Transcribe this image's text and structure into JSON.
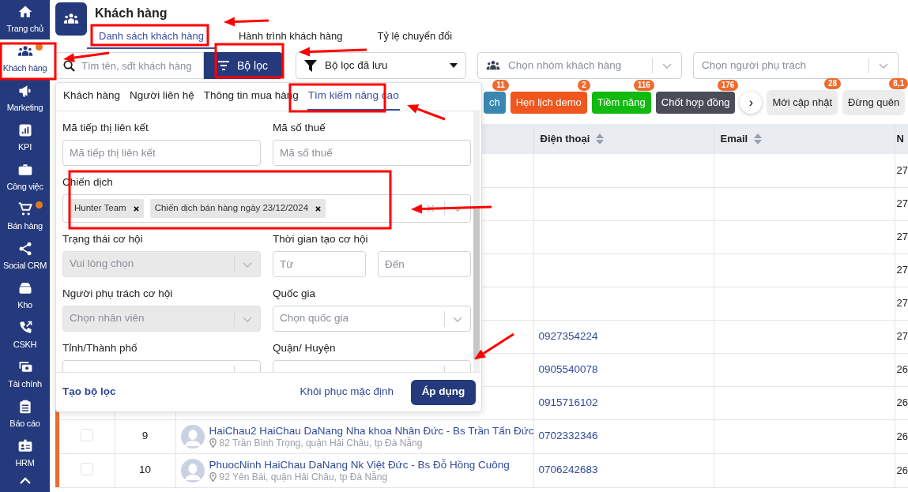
{
  "sidebar": {
    "items": [
      {
        "label": "Trang chủ",
        "selected": false,
        "dot": false
      },
      {
        "label": "Khách hàng",
        "selected": true,
        "dot": true
      },
      {
        "label": "Marketing",
        "selected": false,
        "dot": false
      },
      {
        "label": "KPI",
        "selected": false,
        "dot": false
      },
      {
        "label": "Công việc",
        "selected": false,
        "dot": false
      },
      {
        "label": "Bán hàng",
        "selected": false,
        "dot": true
      },
      {
        "label": "Social CRM",
        "selected": false,
        "dot": false
      },
      {
        "label": "Kho",
        "selected": false,
        "dot": false
      },
      {
        "label": "CSKH",
        "selected": false,
        "dot": false
      },
      {
        "label": "Tài chính",
        "selected": false,
        "dot": false
      },
      {
        "label": "Báo cáo",
        "selected": false,
        "dot": false
      },
      {
        "label": "HRM",
        "selected": false,
        "dot": false
      }
    ]
  },
  "header": {
    "title": "Khách hàng",
    "tabs": [
      {
        "label": "Danh sách khách hàng",
        "selected": true
      },
      {
        "label": "Hành trình khách hàng",
        "selected": false
      },
      {
        "label": "Tỷ lệ chuyển đổi",
        "selected": false
      }
    ]
  },
  "toolbar": {
    "search": {
      "placeholder": "Tìm tên, sđt khách hàng"
    },
    "filter_button": "Bộ lọc",
    "saved_filter": "Bộ lọc đã lưu",
    "group_select": {
      "placeholder": "Chọn nhóm khách hàng"
    },
    "owner_select": {
      "placeholder": "Chọn người phụ trách"
    }
  },
  "chips": [
    {
      "kind": "status",
      "label": "ch",
      "count": "11",
      "color": "#3a87b2"
    },
    {
      "kind": "status",
      "label": "Hẹn lịch demo",
      "count": "2",
      "color": "#f0561d"
    },
    {
      "kind": "status",
      "label": "Tiềm năng",
      "count": "116",
      "color": "#12b90f"
    },
    {
      "kind": "status",
      "label": "Chốt hợp đồng",
      "count": "176",
      "color": "#4a4d58"
    },
    {
      "kind": "scroll",
      "label": "›"
    },
    {
      "kind": "quick",
      "label": "Mới cập nhật",
      "count": "28",
      "color": "#ececec"
    },
    {
      "kind": "quick",
      "label": "Đừng quên",
      "count": "8,1",
      "color": "#ececec"
    }
  ],
  "filter_panel": {
    "tabs": [
      {
        "label": "Khách hàng",
        "selected": false
      },
      {
        "label": "Người liên hệ",
        "selected": false
      },
      {
        "label": "Thông tin mua hàng",
        "selected": false
      },
      {
        "label": "Tìm kiếm nâng cao",
        "selected": true
      }
    ],
    "fields": [
      {
        "kind": "input",
        "label": "Mã tiếp thị liên kết",
        "placeholder": "Mã tiếp thị liên kết"
      },
      {
        "kind": "input",
        "label": "Mã số thuế",
        "placeholder": "Mã số thuế"
      },
      {
        "kind": "tags",
        "label": "Chiến dịch",
        "tags": [
          "Hunter Team",
          "Chiến dịch bán hàng ngày 23/12/2024"
        ]
      },
      {
        "kind": "select",
        "label": "Trạng thái cơ hội",
        "placeholder": "Vui lòng chọn",
        "disabled": true
      },
      {
        "kind": "range",
        "label": "Thời gian tạo cơ hội",
        "placeholders": [
          "Từ",
          "Đến"
        ]
      },
      {
        "kind": "select",
        "label": "Người phụ trách cơ hội",
        "placeholder": "Chọn nhân viên",
        "disabled": true
      },
      {
        "kind": "select",
        "label": "Quốc gia",
        "placeholder": "Chọn quốc gia",
        "disabled": false
      },
      {
        "kind": "select",
        "label": "Tỉnh/Thành phố"
      },
      {
        "kind": "select",
        "label": "Quận/ Huyện"
      }
    ],
    "footer": {
      "create": "Tạo bộ lọc",
      "reset": "Khôi phục mặc định",
      "apply": "Áp dụng"
    }
  },
  "table": {
    "columns": [
      {
        "label": "Điện thoại",
        "sortable": true
      },
      {
        "label": "Email",
        "sortable": true
      },
      {
        "label": "N",
        "sortable": false
      }
    ],
    "rows": [
      {
        "date": "27"
      },
      {
        "date": "27"
      },
      {
        "date": "27"
      },
      {
        "date": "27"
      },
      {
        "date": "27"
      },
      {
        "phone": "0927354224",
        "date": "27"
      },
      {
        "phone": "0905540078",
        "date": "26"
      },
      {
        "phone": "0915716102",
        "date": "26"
      },
      {
        "checked": false,
        "number": "9",
        "name": "HaiChau2 HaiChau DaNang Nha khoa Nhân Đức - Bs Trần Tấn Đức",
        "address": "82 Trần Bình Trọng, quận Hải Châu, tp Đà Nẵng",
        "phone": "0702332346",
        "date": "26"
      },
      {
        "checked": false,
        "number": "10",
        "name": "PhuocNinh HaiChau DaNang Nk Việt Đức - Bs Đỗ Hồng Cuông",
        "address": "92 Yên Bái, quận Hải Châu, tp Đà Nẵng",
        "phone": "0706242683",
        "date": "26"
      }
    ]
  }
}
